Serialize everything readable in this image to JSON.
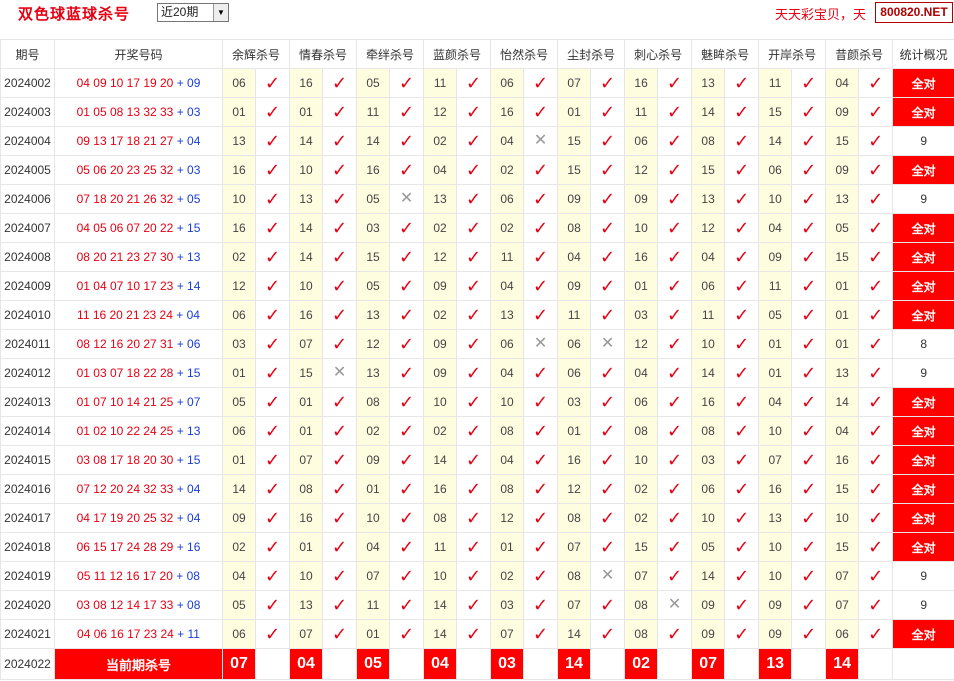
{
  "header": {
    "title": "双色球蓝球杀号",
    "period_select": "近20期",
    "brand_text": "天天彩宝贝，天",
    "brand_box": "800820.NET"
  },
  "columns": {
    "period": "期号",
    "draw": "开奖号码",
    "experts": [
      "余辉杀号",
      "情春杀号",
      "牵绊杀号",
      "蓝颜杀号",
      "怡然杀号",
      "尘封杀号",
      "刺心杀号",
      "魅眸杀号",
      "开岸杀号",
      "昔颜杀号"
    ],
    "stat": "统计概况"
  },
  "rows": [
    {
      "period": "2024002",
      "red": "04 09 10 17 19 20",
      "blue": "09",
      "kills": [
        "06",
        "16",
        "05",
        "11",
        "06",
        "07",
        "16",
        "13",
        "11",
        "04"
      ],
      "hits": [
        1,
        1,
        1,
        1,
        1,
        1,
        1,
        1,
        1,
        1
      ],
      "stat": "全对"
    },
    {
      "period": "2024003",
      "red": "01 05 08 13 32 33",
      "blue": "03",
      "kills": [
        "01",
        "01",
        "11",
        "12",
        "16",
        "01",
        "11",
        "14",
        "15",
        "09"
      ],
      "hits": [
        1,
        1,
        1,
        1,
        1,
        1,
        1,
        1,
        1,
        1
      ],
      "stat": "全对"
    },
    {
      "period": "2024004",
      "red": "09 13 17 18 21 27",
      "blue": "04",
      "kills": [
        "13",
        "14",
        "14",
        "02",
        "04",
        "15",
        "06",
        "08",
        "14",
        "15"
      ],
      "hits": [
        1,
        1,
        1,
        1,
        0,
        1,
        1,
        1,
        1,
        1
      ],
      "stat": "9"
    },
    {
      "period": "2024005",
      "red": "05 06 20 23 25 32",
      "blue": "03",
      "kills": [
        "16",
        "10",
        "16",
        "04",
        "02",
        "15",
        "12",
        "15",
        "06",
        "09"
      ],
      "hits": [
        1,
        1,
        1,
        1,
        1,
        1,
        1,
        1,
        1,
        1
      ],
      "stat": "全对"
    },
    {
      "period": "2024006",
      "red": "07 18 20 21 26 32",
      "blue": "05",
      "kills": [
        "10",
        "13",
        "05",
        "13",
        "06",
        "09",
        "09",
        "13",
        "10",
        "13"
      ],
      "hits": [
        1,
        1,
        0,
        1,
        1,
        1,
        1,
        1,
        1,
        1
      ],
      "stat": "9"
    },
    {
      "period": "2024007",
      "red": "04 05 06 07 20 22",
      "blue": "15",
      "kills": [
        "16",
        "14",
        "03",
        "02",
        "02",
        "08",
        "10",
        "12",
        "04",
        "05"
      ],
      "hits": [
        1,
        1,
        1,
        1,
        1,
        1,
        1,
        1,
        1,
        1
      ],
      "stat": "全对"
    },
    {
      "period": "2024008",
      "red": "08 20 21 23 27 30",
      "blue": "13",
      "kills": [
        "02",
        "14",
        "15",
        "12",
        "11",
        "04",
        "16",
        "04",
        "09",
        "15"
      ],
      "hits": [
        1,
        1,
        1,
        1,
        1,
        1,
        1,
        1,
        1,
        1
      ],
      "stat": "全对"
    },
    {
      "period": "2024009",
      "red": "01 04 07 10 17 23",
      "blue": "14",
      "kills": [
        "12",
        "10",
        "05",
        "09",
        "04",
        "09",
        "01",
        "06",
        "11",
        "01"
      ],
      "hits": [
        1,
        1,
        1,
        1,
        1,
        1,
        1,
        1,
        1,
        1
      ],
      "stat": "全对"
    },
    {
      "period": "2024010",
      "red": "11 16 20 21 23 24",
      "blue": "04",
      "kills": [
        "06",
        "16",
        "13",
        "02",
        "13",
        "11",
        "03",
        "11",
        "05",
        "01"
      ],
      "hits": [
        1,
        1,
        1,
        1,
        1,
        1,
        1,
        1,
        1,
        1
      ],
      "stat": "全对"
    },
    {
      "period": "2024011",
      "red": "08 12 16 20 27 31",
      "blue": "06",
      "kills": [
        "03",
        "07",
        "12",
        "09",
        "06",
        "06",
        "12",
        "10",
        "01",
        "01"
      ],
      "hits": [
        1,
        1,
        1,
        1,
        0,
        0,
        1,
        1,
        1,
        1
      ],
      "stat": "8"
    },
    {
      "period": "2024012",
      "red": "01 03 07 18 22 28",
      "blue": "15",
      "kills": [
        "01",
        "15",
        "13",
        "09",
        "04",
        "06",
        "04",
        "14",
        "01",
        "13"
      ],
      "hits": [
        1,
        0,
        1,
        1,
        1,
        1,
        1,
        1,
        1,
        1
      ],
      "stat": "9"
    },
    {
      "period": "2024013",
      "red": "01 07 10 14 21 25",
      "blue": "07",
      "kills": [
        "05",
        "01",
        "08",
        "10",
        "10",
        "03",
        "06",
        "16",
        "04",
        "14"
      ],
      "hits": [
        1,
        1,
        1,
        1,
        1,
        1,
        1,
        1,
        1,
        1
      ],
      "stat": "全对"
    },
    {
      "period": "2024014",
      "red": "01 02 10 22 24 25",
      "blue": "13",
      "kills": [
        "06",
        "01",
        "02",
        "02",
        "08",
        "01",
        "08",
        "08",
        "10",
        "04"
      ],
      "hits": [
        1,
        1,
        1,
        1,
        1,
        1,
        1,
        1,
        1,
        1
      ],
      "stat": "全对"
    },
    {
      "period": "2024015",
      "red": "03 08 17 18 20 30",
      "blue": "15",
      "kills": [
        "01",
        "07",
        "09",
        "14",
        "04",
        "16",
        "10",
        "03",
        "07",
        "16"
      ],
      "hits": [
        1,
        1,
        1,
        1,
        1,
        1,
        1,
        1,
        1,
        1
      ],
      "stat": "全对"
    },
    {
      "period": "2024016",
      "red": "07 12 20 24 32 33",
      "blue": "04",
      "kills": [
        "14",
        "08",
        "01",
        "16",
        "08",
        "12",
        "02",
        "06",
        "16",
        "15"
      ],
      "hits": [
        1,
        1,
        1,
        1,
        1,
        1,
        1,
        1,
        1,
        1
      ],
      "stat": "全对"
    },
    {
      "period": "2024017",
      "red": "04 17 19 20 25 32",
      "blue": "04",
      "kills": [
        "09",
        "16",
        "10",
        "08",
        "12",
        "08",
        "02",
        "10",
        "13",
        "10"
      ],
      "hits": [
        1,
        1,
        1,
        1,
        1,
        1,
        1,
        1,
        1,
        1
      ],
      "stat": "全对"
    },
    {
      "period": "2024018",
      "red": "06 15 17 24 28 29",
      "blue": "16",
      "kills": [
        "02",
        "01",
        "04",
        "11",
        "01",
        "07",
        "15",
        "05",
        "10",
        "15"
      ],
      "hits": [
        1,
        1,
        1,
        1,
        1,
        1,
        1,
        1,
        1,
        1
      ],
      "stat": "全对"
    },
    {
      "period": "2024019",
      "red": "05 11 12 16 17 20",
      "blue": "08",
      "kills": [
        "04",
        "10",
        "07",
        "10",
        "02",
        "08",
        "07",
        "14",
        "10",
        "07"
      ],
      "hits": [
        1,
        1,
        1,
        1,
        1,
        0,
        1,
        1,
        1,
        1
      ],
      "stat": "9"
    },
    {
      "period": "2024020",
      "red": "03 08 12 14 17 33",
      "blue": "08",
      "kills": [
        "05",
        "13",
        "11",
        "14",
        "03",
        "07",
        "08",
        "09",
        "09",
        "07"
      ],
      "hits": [
        1,
        1,
        1,
        1,
        1,
        1,
        0,
        1,
        1,
        1
      ],
      "stat": "9"
    },
    {
      "period": "2024021",
      "red": "04 06 16 17 23 24",
      "blue": "11",
      "kills": [
        "06",
        "07",
        "01",
        "14",
        "07",
        "14",
        "08",
        "09",
        "09",
        "06"
      ],
      "hits": [
        1,
        1,
        1,
        1,
        1,
        1,
        1,
        1,
        1,
        1
      ],
      "stat": "全对"
    }
  ],
  "current": {
    "period": "2024022",
    "label": "当前期杀号",
    "predictions": [
      "07",
      "04",
      "05",
      "04",
      "03",
      "14",
      "02",
      "07",
      "13",
      "14"
    ]
  },
  "symbols": {
    "hit": "✓",
    "miss": "✕"
  },
  "colors": {
    "accent": "#e60012",
    "blue_ball": "#1a3fd0",
    "cell_bg": "#fffde0"
  }
}
